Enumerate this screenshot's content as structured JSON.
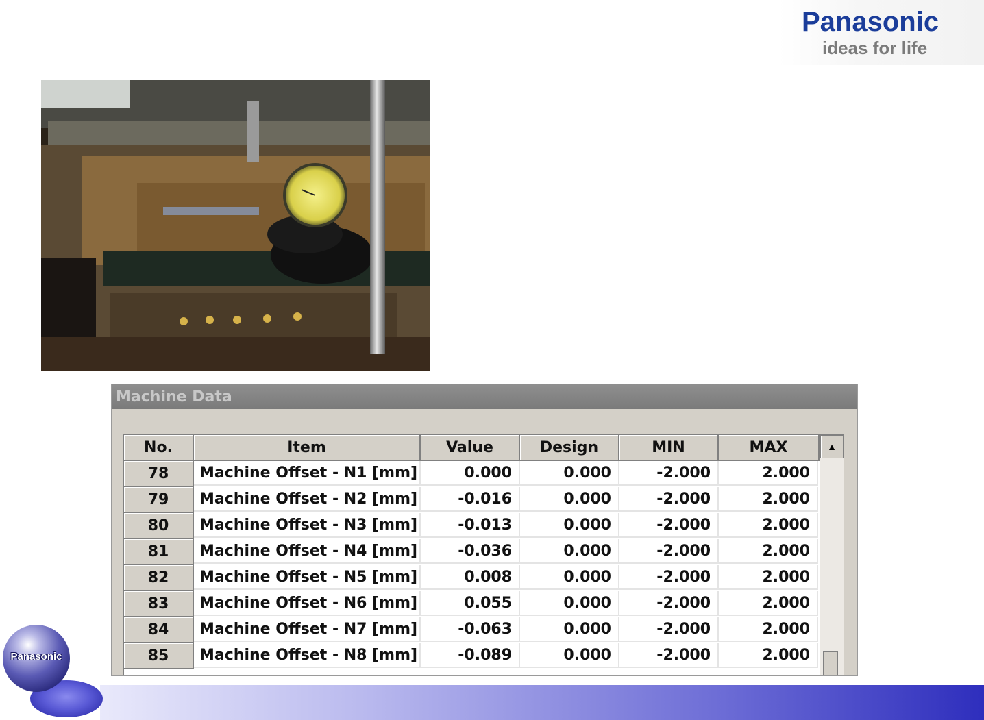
{
  "brand": {
    "name": "Panasonic",
    "tagline": "ideas for life"
  },
  "window": {
    "title": "Machine Data",
    "columns": [
      "No.",
      "Item",
      "Value",
      "Design",
      "MIN",
      "MAX"
    ],
    "rows": [
      {
        "no": "78",
        "item": "Machine Offset - N1 [mm]",
        "value": "0.000",
        "design": "0.000",
        "min": "-2.000",
        "max": "2.000"
      },
      {
        "no": "79",
        "item": "Machine Offset - N2 [mm]",
        "value": "-0.016",
        "design": "0.000",
        "min": "-2.000",
        "max": "2.000"
      },
      {
        "no": "80",
        "item": "Machine Offset - N3 [mm]",
        "value": "-0.013",
        "design": "0.000",
        "min": "-2.000",
        "max": "2.000"
      },
      {
        "no": "81",
        "item": "Machine Offset - N4 [mm]",
        "value": "-0.036",
        "design": "0.000",
        "min": "-2.000",
        "max": "2.000"
      },
      {
        "no": "82",
        "item": "Machine Offset - N5 [mm]",
        "value": "0.008",
        "design": "0.000",
        "min": "-2.000",
        "max": "2.000"
      },
      {
        "no": "83",
        "item": "Machine Offset - N6 [mm]",
        "value": "0.055",
        "design": "0.000",
        "min": "-2.000",
        "max": "2.000"
      },
      {
        "no": "84",
        "item": "Machine Offset - N7 [mm]",
        "value": "-0.063",
        "design": "0.000",
        "min": "-2.000",
        "max": "2.000"
      },
      {
        "no": "85",
        "item": "Machine Offset - N8 [mm]",
        "value": "-0.089",
        "design": "0.000",
        "min": "-2.000",
        "max": "2.000"
      }
    ]
  },
  "footer": {
    "logo_label": "Panasonic"
  },
  "colors": {
    "brand_blue": "#1b3d9a",
    "footer_blue": "#2e2ebd"
  }
}
